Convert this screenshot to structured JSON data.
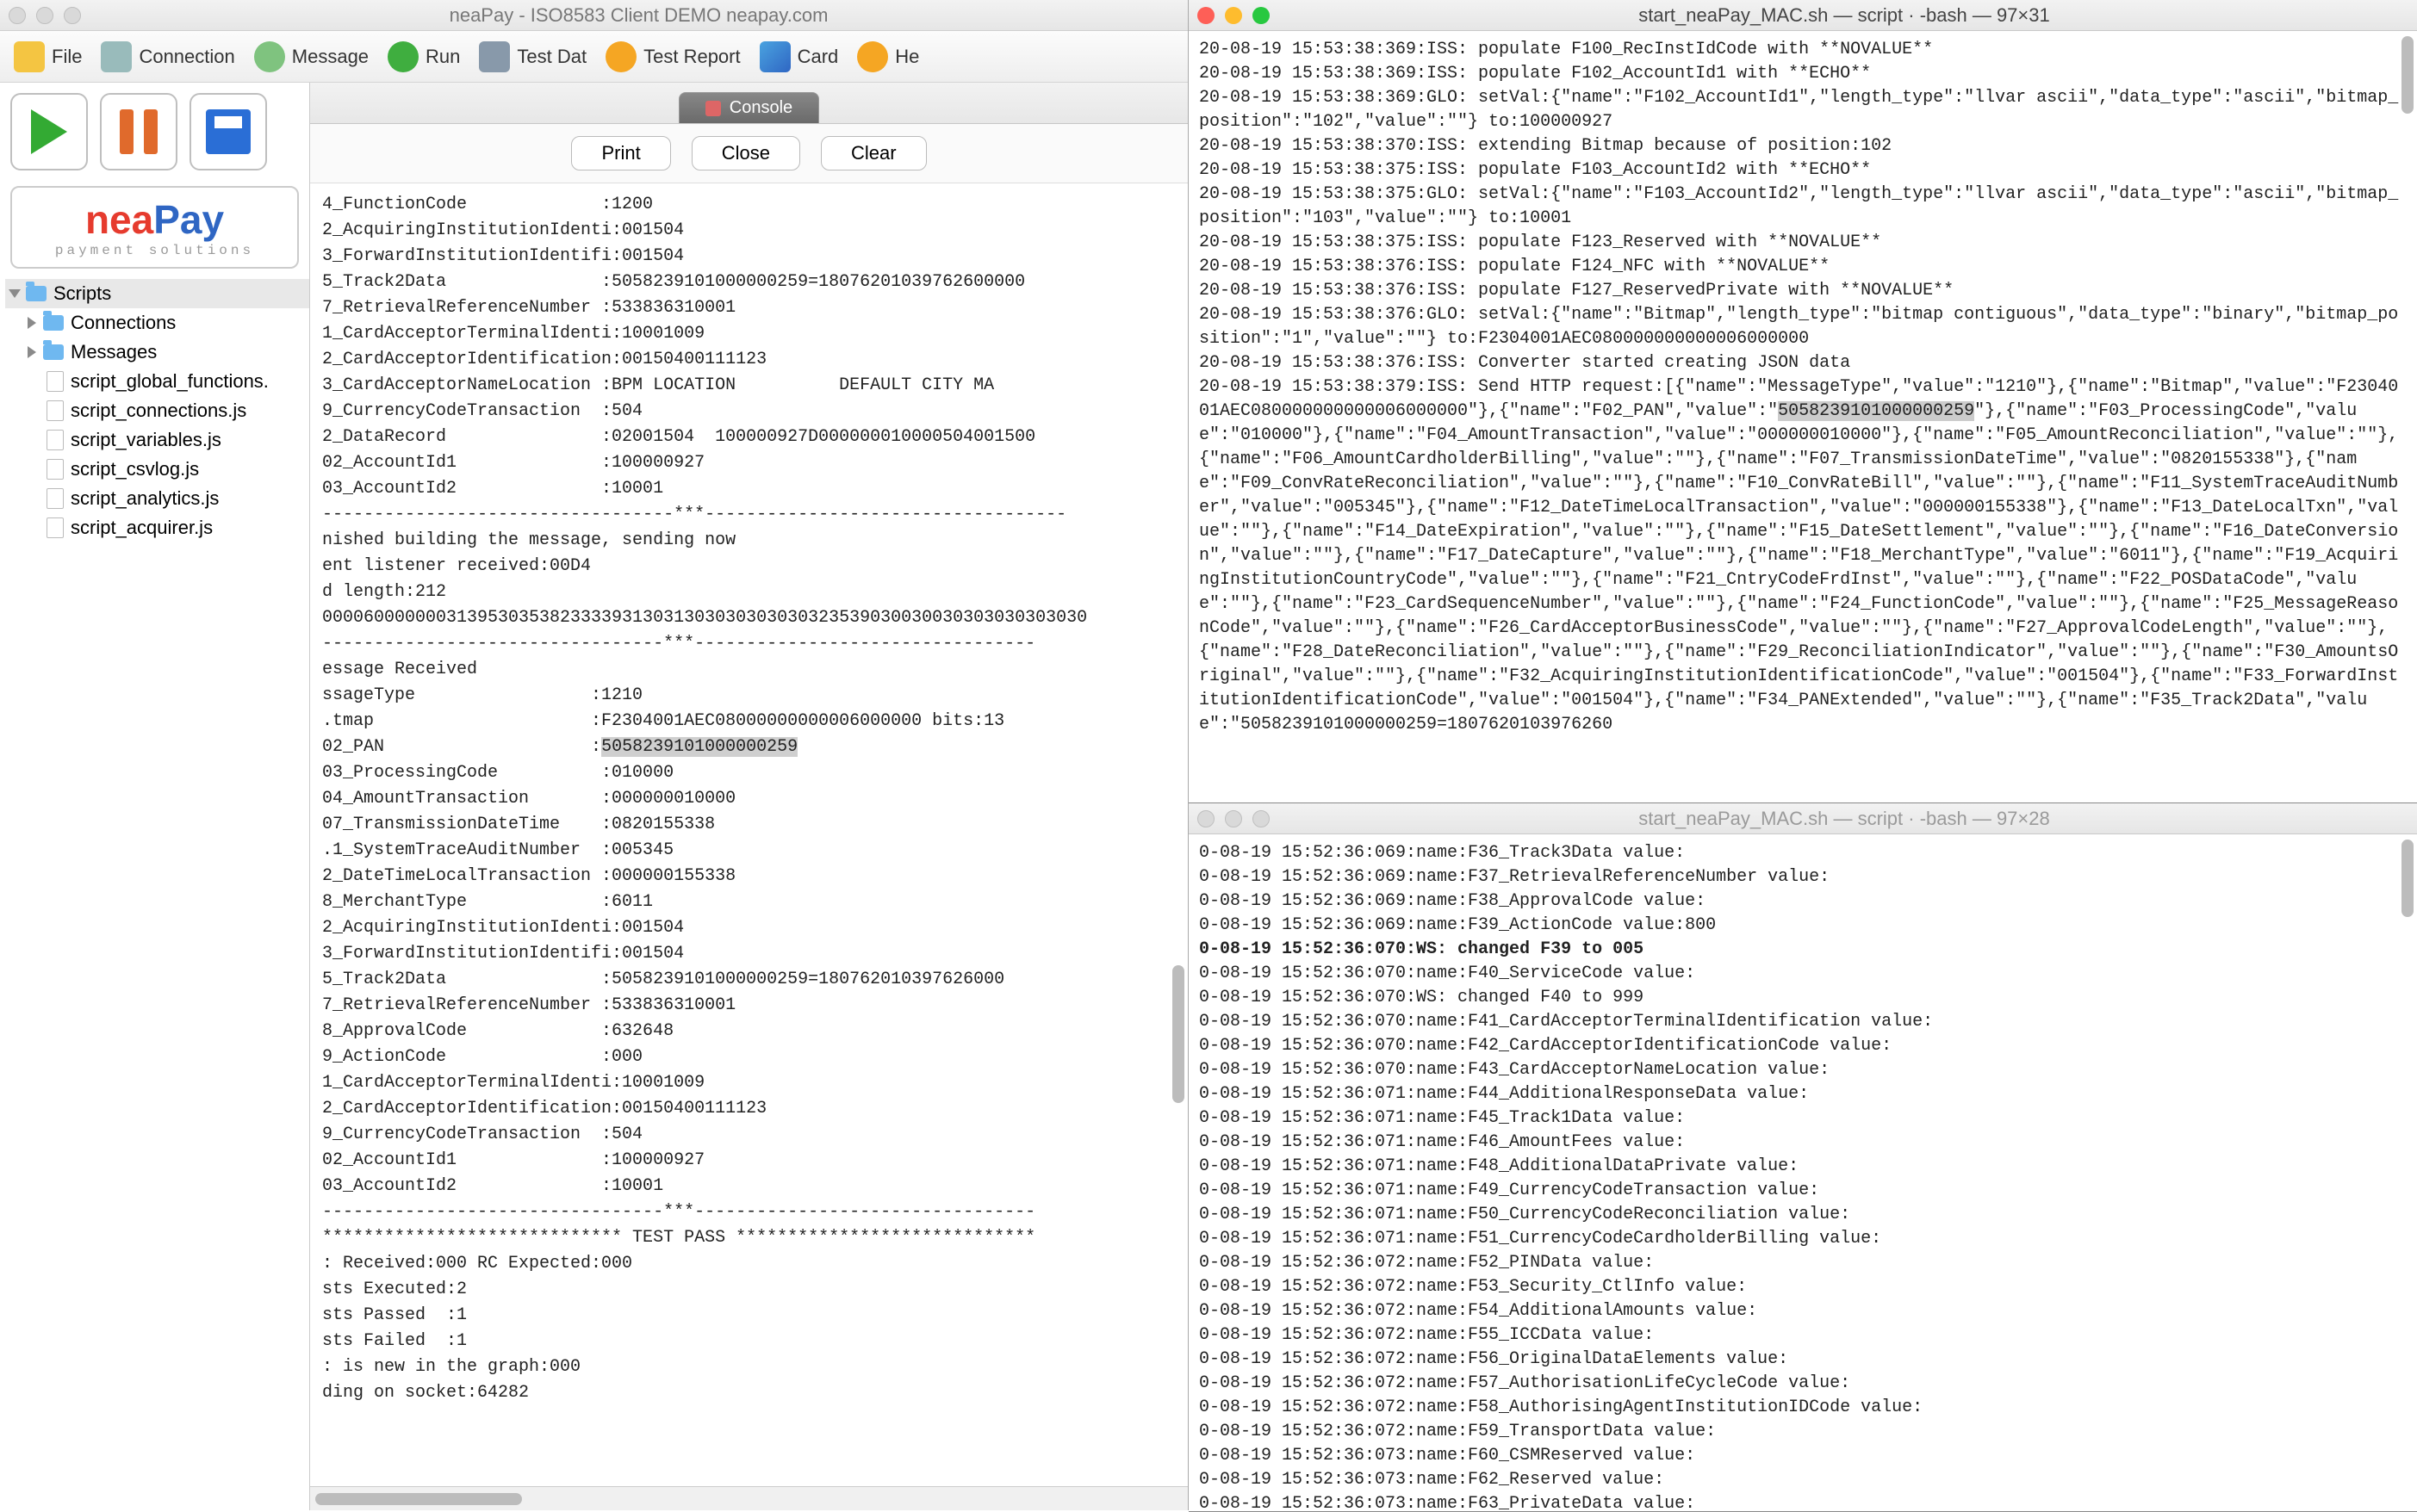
{
  "app": {
    "title": "neaPay - ISO8583 Client DEMO neapay.com",
    "logo_main_nea": "nea",
    "logo_main_pay": "Pay",
    "logo_sub": "payment solutions"
  },
  "toolbar": {
    "file": "File",
    "connection": "Connection",
    "message": "Message",
    "run": "Run",
    "testdat": "Test Dat",
    "testreport": "Test Report",
    "cards": "Card",
    "help": "He"
  },
  "console": {
    "tab": "Console",
    "print": "Print",
    "close": "Close",
    "clear": "Clear"
  },
  "tree": {
    "scripts": "Scripts",
    "connections": "Connections",
    "messages": "Messages",
    "files": [
      "script_global_functions.",
      "script_connections.js",
      "script_variables.js",
      "script_csvlog.js",
      "script_analytics.js",
      "script_acquirer.js"
    ]
  },
  "console_out": {
    "line1": "4_FunctionCode             :1200",
    "line2": "2_AcquiringInstitutionIdenti:001504",
    "line3": "3_ForwardInstitutionIdentifi:001504",
    "line4": "5_Track2Data               :5058239101000000259=18076201039762600000",
    "line5": "7_RetrievalReferenceNumber :533836310001",
    "line6": "1_CardAcceptorTerminalIdenti:10001009",
    "line7": "2_CardAcceptorIdentification:00150400111123",
    "line8": "3_CardAcceptorNameLocation :BPM LOCATION          DEFAULT CITY MA",
    "line9": "9_CurrencyCodeTransaction  :504",
    "line10": "2_DataRecord               :02001504  100000927D000000010000504001500",
    "line11": "02_AccountId1              :100000927",
    "line12": "03_AccountId2              :10001",
    "line13": "----------------------------------***-----------------------------------",
    "line14": "nished building the message, sending now",
    "line15": "ent listener received:00D4",
    "line16": "d length:212",
    "line17": "00006000000031395303538233339313031303030303030323539030030030303030303030",
    "line18": "---------------------------------***---------------------------------",
    "line19": "essage Received",
    "line20": "ssageType                 :1210",
    "line21": ".tmap                     :F2304001AEC08000000000006000000 bits:13",
    "line22_a": "02_PAN                    :",
    "line22_b": "5058239101000000259",
    "line23": "03_ProcessingCode          :010000",
    "line24": "04_AmountTransaction       :000000010000",
    "line25": "07_TransmissionDateTime    :0820155338",
    "line26": ".1_SystemTraceAuditNumber  :005345",
    "line27": "2_DateTimeLocalTransaction :000000155338",
    "line28": "8_MerchantType             :6011",
    "line29": "2_AcquiringInstitutionIdenti:001504",
    "line30": "3_ForwardInstitutionIdentifi:001504",
    "line31": "5_Track2Data               :5058239101000000259=180762010397626000",
    "line32": "7_RetrievalReferenceNumber :533836310001",
    "line33": "8_ApprovalCode             :632648",
    "line34": "9_ActionCode               :000",
    "line35": "1_CardAcceptorTerminalIdenti:10001009",
    "line36": "2_CardAcceptorIdentification:00150400111123",
    "line37": "9_CurrencyCodeTransaction  :504",
    "line38": "02_AccountId1              :100000927",
    "line39": "03_AccountId2              :10001",
    "line40": "---------------------------------***---------------------------------",
    "line41": "***************************** TEST PASS *****************************",
    "line42": ": Received:000 RC Expected:000",
    "line43": "sts Executed:2",
    "line44": "sts Passed  :1",
    "line45": "sts Failed  :1",
    "line46": ": is new in the graph:000",
    "line47": "ding on socket:64282"
  },
  "term1": {
    "title": "start_neaPay_MAC.sh — script · -bash — 97×31",
    "l1": "20-08-19 15:53:38:369:ISS: populate F100_RecInstIdCode with **NOVALUE**",
    "l2": "20-08-19 15:53:38:369:ISS: populate F102_AccountId1 with **ECHO**",
    "l3": "20-08-19 15:53:38:369:GLO: setVal:{\"name\":\"F102_AccountId1\",\"length_type\":\"llvar ascii\",\"data_type\":\"ascii\",\"bitmap_position\":\"102\",\"value\":\"\"} to:100000927",
    "l4": "20-08-19 15:53:38:370:ISS: extending Bitmap because of position:102",
    "l5": "20-08-19 15:53:38:375:ISS: populate F103_AccountId2 with **ECHO**",
    "l6": "20-08-19 15:53:38:375:GLO: setVal:{\"name\":\"F103_AccountId2\",\"length_type\":\"llvar ascii\",\"data_type\":\"ascii\",\"bitmap_position\":\"103\",\"value\":\"\"} to:10001",
    "l7": "20-08-19 15:53:38:375:ISS: populate F123_Reserved with **NOVALUE**",
    "l8": "20-08-19 15:53:38:376:ISS: populate F124_NFC with **NOVALUE**",
    "l9": "20-08-19 15:53:38:376:ISS: populate F127_ReservedPrivate with **NOVALUE**",
    "l10": "20-08-19 15:53:38:376:GLO: setVal:{\"name\":\"Bitmap\",\"length_type\":\"bitmap contiguous\",\"data_type\":\"binary\",\"bitmap_position\":\"1\",\"value\":\"\"} to:F2304001AEC080000000000006000000",
    "l11": "20-08-19 15:53:38:376:ISS: Converter started creating JSON data",
    "l12a": "20-08-19 15:53:38:379:ISS: Send HTTP request:[{\"name\":\"MessageType\",\"value\":\"1210\"},{\"name\":\"Bitmap\",\"value\":\"F2304001AEC080000000000006000000\"},{\"name\":\"F02_PAN\",\"value\":\"",
    "l12b": "5058239101000000259",
    "l12c": "\"},{\"name\":\"F03_ProcessingCode\",\"value\":\"010000\"},{\"name\":\"F04_AmountTransaction\",\"value\":\"000000010000\"},{\"name\":\"F05_AmountReconciliation\",\"value\":\"\"},{\"name\":\"F06_AmountCardholderBilling\",\"value\":\"\"},{\"name\":\"F07_TransmissionDateTime\",\"value\":\"0820155338\"},{\"name\":\"F09_ConvRateReconciliation\",\"value\":\"\"},{\"name\":\"F10_ConvRateBill\",\"value\":\"\"},{\"name\":\"F11_SystemTraceAuditNumber\",\"value\":\"005345\"},{\"name\":\"F12_DateTimeLocalTransaction\",\"value\":\"000000155338\"},{\"name\":\"F13_DateLocalTxn\",\"value\":\"\"},{\"name\":\"F14_DateExpiration\",\"value\":\"\"},{\"name\":\"F15_DateSettlement\",\"value\":\"\"},{\"name\":\"F16_DateConversion\",\"value\":\"\"},{\"name\":\"F17_DateCapture\",\"value\":\"\"},{\"name\":\"F18_MerchantType\",\"value\":\"6011\"},{\"name\":\"F19_AcquiringInstitutionCountryCode\",\"value\":\"\"},{\"name\":\"F21_CntryCodeFrdInst\",\"value\":\"\"},{\"name\":\"F22_POSDataCode\",\"value\":\"\"},{\"name\":\"F23_CardSequenceNumber\",\"value\":\"\"},{\"name\":\"F24_FunctionCode\",\"value\":\"\"},{\"name\":\"F25_MessageReasonCode\",\"value\":\"\"},{\"name\":\"F26_CardAcceptorBusinessCode\",\"value\":\"\"},{\"name\":\"F27_ApprovalCodeLength\",\"value\":\"\"},{\"name\":\"F28_DateReconciliation\",\"value\":\"\"},{\"name\":\"F29_ReconciliationIndicator\",\"value\":\"\"},{\"name\":\"F30_AmountsOriginal\",\"value\":\"\"},{\"name\":\"F32_AcquiringInstitutionIdentificationCode\",\"value\":\"001504\"},{\"name\":\"F33_ForwardInstitutionIdentificationCode\",\"value\":\"001504\"},{\"name\":\"F34_PANExtended\",\"value\":\"\"},{\"name\":\"F35_Track2Data\",\"value\":\"5058239101000000259=1807620103976260"
  },
  "term2": {
    "title": "start_neaPay_MAC.sh — script · -bash — 97×28",
    "lines": [
      "0-08-19 15:52:36:069:name:F36_Track3Data value:",
      "0-08-19 15:52:36:069:name:F37_RetrievalReferenceNumber value:",
      "0-08-19 15:52:36:069:name:F38_ApprovalCode value:",
      "0-08-19 15:52:36:069:name:F39_ActionCode value:800",
      "0-08-19 15:52:36:070:WS: changed F39 to 005",
      "0-08-19 15:52:36:070:name:F40_ServiceCode value:",
      "0-08-19 15:52:36:070:WS: changed F40 to 999",
      "0-08-19 15:52:36:070:name:F41_CardAcceptorTerminalIdentification value:",
      "0-08-19 15:52:36:070:name:F42_CardAcceptorIdentificationCode value:",
      "0-08-19 15:52:36:070:name:F43_CardAcceptorNameLocation value:",
      "0-08-19 15:52:36:071:name:F44_AdditionalResponseData value:",
      "0-08-19 15:52:36:071:name:F45_Track1Data value:",
      "0-08-19 15:52:36:071:name:F46_AmountFees value:",
      "0-08-19 15:52:36:071:name:F48_AdditionalDataPrivate value:",
      "0-08-19 15:52:36:071:name:F49_CurrencyCodeTransaction value:",
      "0-08-19 15:52:36:071:name:F50_CurrencyCodeReconciliation value:",
      "0-08-19 15:52:36:071:name:F51_CurrencyCodeCardholderBilling value:",
      "0-08-19 15:52:36:072:name:F52_PINData value:",
      "0-08-19 15:52:36:072:name:F53_Security_CtlInfo value:",
      "0-08-19 15:52:36:072:name:F54_AdditionalAmounts value:",
      "0-08-19 15:52:36:072:name:F55_ICCData value:",
      "0-08-19 15:52:36:072:name:F56_OriginalDataElements value:",
      "0-08-19 15:52:36:072:name:F57_AuthorisationLifeCycleCode value:",
      "0-08-19 15:52:36:072:name:F58_AuthorisingAgentInstitutionIDCode value:",
      "0-08-19 15:52:36:072:name:F59_TransportData value:",
      "0-08-19 15:52:36:073:name:F60_CSMReserved value:",
      "0-08-19 15:52:36:073:name:F62_Reserved value:",
      "0-08-19 15:52:36:073:name:F63_PrivateData value:"
    ],
    "bold_idx": 4
  }
}
